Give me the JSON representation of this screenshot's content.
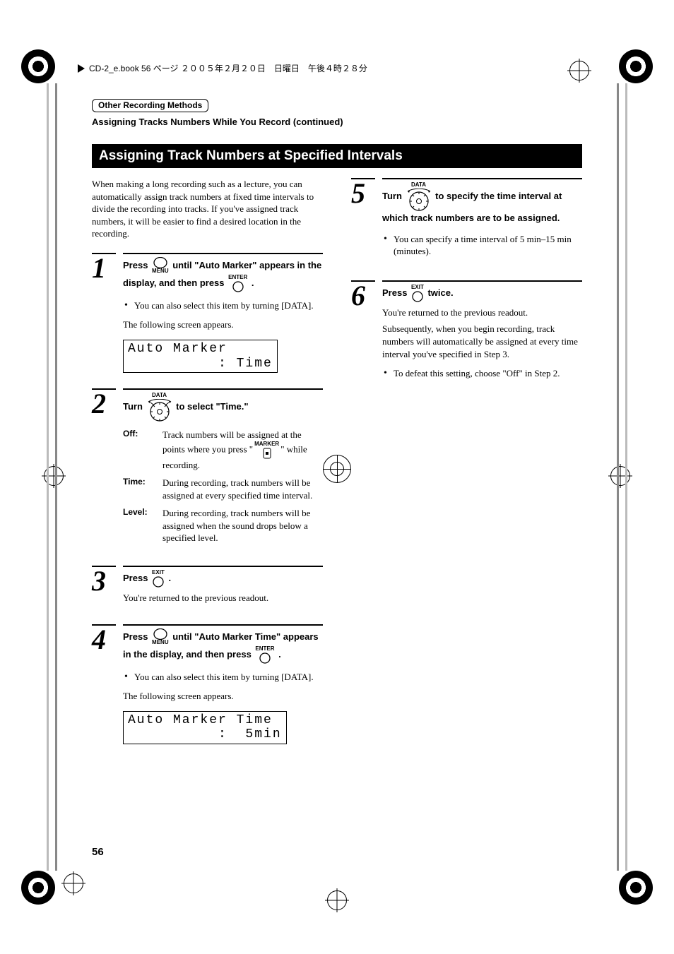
{
  "slug": "CD-2_e.book 56 ページ ２００５年２月２０日　日曜日　午後４時２８分",
  "header": {
    "tag": "Other Recording Methods",
    "continued": "Assigning Tracks Numbers While You Record (continued)"
  },
  "section_title": "Assigning Track Numbers at Specified Intervals",
  "intro": "When making a long recording such as a lecture, you can automatically assign track numbers at fixed time intervals to divide the recording into tracks. If you've assigned track numbers, it will be easier to find a desired location in the recording.",
  "icons": {
    "menu_label": "MENU",
    "enter_label": "ENTER",
    "data_label": "DATA",
    "exit_label": "EXIT",
    "marker_label": "MARKER"
  },
  "steps": {
    "s1": {
      "num": "1",
      "t_a": "Press ",
      "t_b": " until \"Auto Marker\" appears in the display, and then press ",
      "t_c": " .",
      "bullet": "You can also select this item by turning [DATA].",
      "after": "The following screen appears.",
      "lcd": "Auto Marker\n          : Time"
    },
    "s2": {
      "num": "2",
      "t_a": "Turn ",
      "t_b": " to select \"Time.\"",
      "defs": {
        "off": {
          "term": "Off:",
          "desc_a": "Track numbers will be assigned at the points where you press \"",
          "desc_b": "\" while recording."
        },
        "time": {
          "term": "Time:",
          "desc": "During recording, track numbers will be assigned at every specified time interval."
        },
        "level": {
          "term": "Level:",
          "desc": "During recording, track numbers will be assigned when the sound drops below a specified level."
        }
      }
    },
    "s3": {
      "num": "3",
      "t_a": "Press ",
      "t_b": " .",
      "after": "You're returned to the previous readout."
    },
    "s4": {
      "num": "4",
      "t_a": "Press ",
      "t_b": " until \"Auto Marker Time\" appears in the display, and then press ",
      "t_c": " .",
      "bullet": "You can also select this item by turning [DATA].",
      "after": "The following screen appears.",
      "lcd": "Auto Marker Time\n          :  5min"
    },
    "s5": {
      "num": "5",
      "t_a": "Turn ",
      "t_b": " to specify the time interval at which track numbers are to be assigned.",
      "bullet": "You can specify a time interval of 5 min–15 min (minutes)."
    },
    "s6": {
      "num": "6",
      "t_a": "Press ",
      "t_b": " twice.",
      "after1": "You're returned to the previous readout.",
      "after2": "Subsequently, when you begin recording, track numbers will automatically be assigned at every time interval you've specified in Step 3.",
      "bullet": "To defeat this setting, choose \"Off\" in Step 2."
    }
  },
  "page_number": "56"
}
